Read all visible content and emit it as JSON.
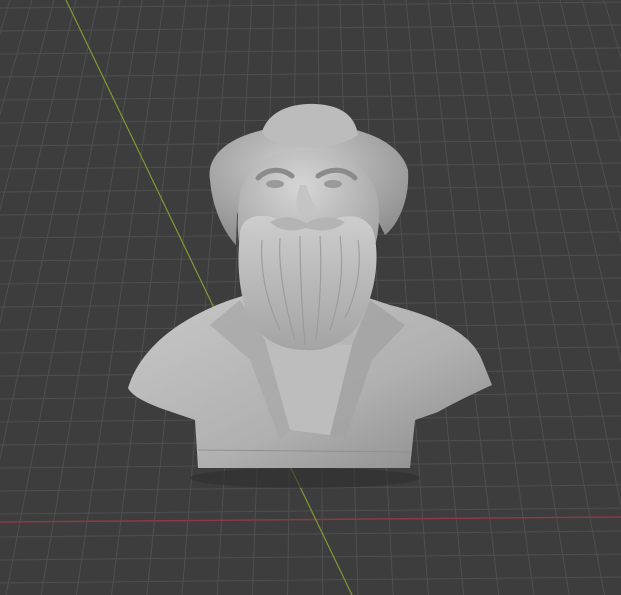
{
  "viewport": {
    "background_color": "#3d3d3d",
    "grid_color": "#4f4f4f",
    "grid_major_color": "#555555",
    "x_axis_color": "#8a3a44",
    "y_axis_color": "#7f9a34"
  },
  "scene": {
    "object_icon": "bust-sculpture",
    "object_color": "#b9b9b9"
  }
}
